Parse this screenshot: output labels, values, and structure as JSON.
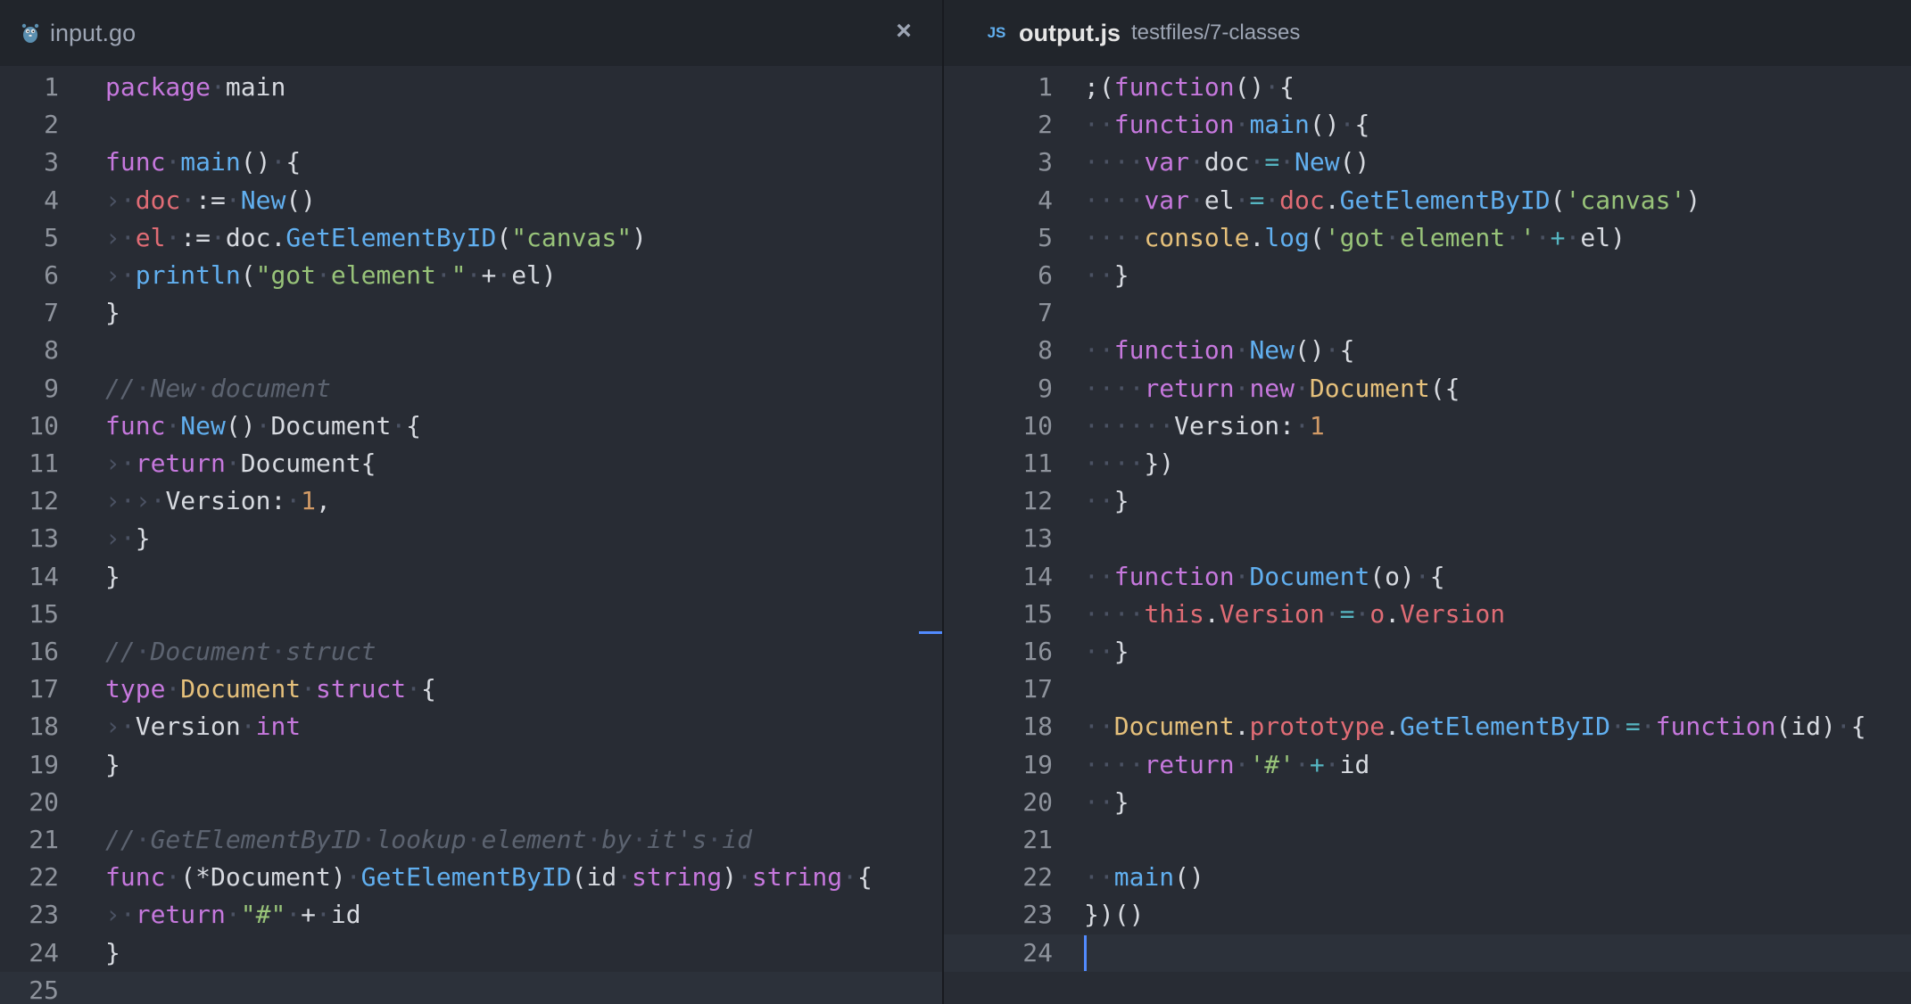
{
  "left_pane": {
    "tab": {
      "icon": "gopher-icon",
      "title": "input.go",
      "close": "×"
    },
    "lines": [
      [
        [
          "package",
          "kw"
        ],
        [
          "·",
          "ws"
        ],
        [
          "main",
          "plain"
        ]
      ],
      [],
      [
        [
          "func",
          "kw"
        ],
        [
          "·",
          "ws"
        ],
        [
          "main",
          "fn"
        ],
        [
          "()",
          "plain"
        ],
        [
          "·",
          "ws"
        ],
        [
          "{",
          "plain"
        ]
      ],
      [
        [
          "›",
          "ws"
        ],
        [
          "·",
          "ws"
        ],
        [
          "doc",
          "var"
        ],
        [
          "·",
          "ws"
        ],
        [
          ":=",
          "plain"
        ],
        [
          "·",
          "ws"
        ],
        [
          "New",
          "fn"
        ],
        [
          "()",
          "plain"
        ]
      ],
      [
        [
          "›",
          "ws"
        ],
        [
          "·",
          "ws"
        ],
        [
          "el",
          "var"
        ],
        [
          "·",
          "ws"
        ],
        [
          ":=",
          "plain"
        ],
        [
          "·",
          "ws"
        ],
        [
          "doc.",
          "plain"
        ],
        [
          "GetElementByID",
          "fn"
        ],
        [
          "(",
          "plain"
        ],
        [
          "\"canvas\"",
          "str"
        ],
        [
          ")",
          "plain"
        ]
      ],
      [
        [
          "›",
          "ws"
        ],
        [
          "·",
          "ws"
        ],
        [
          "println",
          "fn"
        ],
        [
          "(",
          "plain"
        ],
        [
          "\"got",
          "str"
        ],
        [
          "·",
          "ws"
        ],
        [
          "element",
          "str"
        ],
        [
          "·",
          "ws"
        ],
        [
          "\"",
          "str"
        ],
        [
          "·",
          "ws"
        ],
        [
          "+",
          "plain"
        ],
        [
          "·",
          "ws"
        ],
        [
          "el",
          "plain"
        ],
        [
          ")",
          "plain"
        ]
      ],
      [
        [
          "}",
          "plain"
        ]
      ],
      [],
      [
        [
          "//",
          "cm"
        ],
        [
          "·",
          "ws"
        ],
        [
          "New",
          "cm"
        ],
        [
          "·",
          "ws"
        ],
        [
          "document",
          "cm"
        ]
      ],
      [
        [
          "func",
          "kw"
        ],
        [
          "·",
          "ws"
        ],
        [
          "New",
          "fn"
        ],
        [
          "()",
          "plain"
        ],
        [
          "·",
          "ws"
        ],
        [
          "Document",
          "plain"
        ],
        [
          "·",
          "ws"
        ],
        [
          "{",
          "plain"
        ]
      ],
      [
        [
          "›",
          "ws"
        ],
        [
          "·",
          "ws"
        ],
        [
          "return",
          "kw"
        ],
        [
          "·",
          "ws"
        ],
        [
          "Document{",
          "plain"
        ]
      ],
      [
        [
          "›",
          "ws"
        ],
        [
          "·",
          "ws"
        ],
        [
          "›",
          "ws"
        ],
        [
          "·",
          "ws"
        ],
        [
          "Version:",
          "plain"
        ],
        [
          "·",
          "ws"
        ],
        [
          "1",
          "num"
        ],
        [
          ",",
          "plain"
        ]
      ],
      [
        [
          "›",
          "ws"
        ],
        [
          "·",
          "ws"
        ],
        [
          "}",
          "plain"
        ]
      ],
      [
        [
          "}",
          "plain"
        ]
      ],
      [],
      [
        [
          "//",
          "cm"
        ],
        [
          "·",
          "ws"
        ],
        [
          "Document",
          "cm"
        ],
        [
          "·",
          "ws"
        ],
        [
          "struct",
          "cm"
        ]
      ],
      [
        [
          "type",
          "kw"
        ],
        [
          "·",
          "ws"
        ],
        [
          "Document",
          "type"
        ],
        [
          "·",
          "ws"
        ],
        [
          "struct",
          "kw"
        ],
        [
          "·",
          "ws"
        ],
        [
          "{",
          "plain"
        ]
      ],
      [
        [
          "›",
          "ws"
        ],
        [
          "·",
          "ws"
        ],
        [
          "Version",
          "plain"
        ],
        [
          "·",
          "ws"
        ],
        [
          "int",
          "kw"
        ]
      ],
      [
        [
          "}",
          "plain"
        ]
      ],
      [],
      [
        [
          "//",
          "cm"
        ],
        [
          "·",
          "ws"
        ],
        [
          "GetElementByID",
          "cm"
        ],
        [
          "·",
          "ws"
        ],
        [
          "lookup",
          "cm"
        ],
        [
          "·",
          "ws"
        ],
        [
          "element",
          "cm"
        ],
        [
          "·",
          "ws"
        ],
        [
          "by",
          "cm"
        ],
        [
          "·",
          "ws"
        ],
        [
          "it's",
          "cm"
        ],
        [
          "·",
          "ws"
        ],
        [
          "id",
          "cm"
        ]
      ],
      [
        [
          "func",
          "kw"
        ],
        [
          "·",
          "ws"
        ],
        [
          "(*Document)",
          "plain"
        ],
        [
          "·",
          "ws"
        ],
        [
          "GetElementByID",
          "fn"
        ],
        [
          "(id",
          "plain"
        ],
        [
          "·",
          "ws"
        ],
        [
          "string",
          "kw"
        ],
        [
          ")",
          "plain"
        ],
        [
          "·",
          "ws"
        ],
        [
          "string",
          "kw"
        ],
        [
          "·",
          "ws"
        ],
        [
          "{",
          "plain"
        ]
      ],
      [
        [
          "›",
          "ws"
        ],
        [
          "·",
          "ws"
        ],
        [
          "return",
          "kw"
        ],
        [
          "·",
          "ws"
        ],
        [
          "\"#\"",
          "str"
        ],
        [
          "·",
          "ws"
        ],
        [
          "+",
          "plain"
        ],
        [
          "·",
          "ws"
        ],
        [
          "id",
          "plain"
        ]
      ],
      [
        [
          "}",
          "plain"
        ]
      ],
      []
    ]
  },
  "right_pane": {
    "tab": {
      "icon": "javascript-icon",
      "icon_text": "JS",
      "title": "output.js",
      "path": "testfiles/7-classes"
    },
    "lines": [
      [
        [
          ";(",
          "plain"
        ],
        [
          "function",
          "kw"
        ],
        [
          "()",
          "plain"
        ],
        [
          "·",
          "ws"
        ],
        [
          "{",
          "plain"
        ]
      ],
      [
        [
          "·",
          "ws"
        ],
        [
          "·",
          "ws"
        ],
        [
          "function",
          "kw"
        ],
        [
          "·",
          "ws"
        ],
        [
          "main",
          "fn"
        ],
        [
          "()",
          "plain"
        ],
        [
          "·",
          "ws"
        ],
        [
          "{",
          "plain"
        ]
      ],
      [
        [
          "·",
          "ws"
        ],
        [
          "·",
          "ws"
        ],
        [
          "·",
          "ws"
        ],
        [
          "·",
          "ws"
        ],
        [
          "var",
          "kw"
        ],
        [
          "·",
          "ws"
        ],
        [
          "doc",
          "plain"
        ],
        [
          "·",
          "ws"
        ],
        [
          "=",
          "op"
        ],
        [
          "·",
          "ws"
        ],
        [
          "New",
          "fn"
        ],
        [
          "()",
          "plain"
        ]
      ],
      [
        [
          "·",
          "ws"
        ],
        [
          "·",
          "ws"
        ],
        [
          "·",
          "ws"
        ],
        [
          "·",
          "ws"
        ],
        [
          "var",
          "kw"
        ],
        [
          "·",
          "ws"
        ],
        [
          "el",
          "plain"
        ],
        [
          "·",
          "ws"
        ],
        [
          "=",
          "op"
        ],
        [
          "·",
          "ws"
        ],
        [
          "doc",
          "var"
        ],
        [
          ".",
          "plain"
        ],
        [
          "GetElementByID",
          "fn"
        ],
        [
          "(",
          "plain"
        ],
        [
          "'canvas'",
          "str"
        ],
        [
          ")",
          "plain"
        ]
      ],
      [
        [
          "·",
          "ws"
        ],
        [
          "·",
          "ws"
        ],
        [
          "·",
          "ws"
        ],
        [
          "·",
          "ws"
        ],
        [
          "console",
          "type"
        ],
        [
          ".",
          "plain"
        ],
        [
          "log",
          "fn"
        ],
        [
          "(",
          "plain"
        ],
        [
          "'got",
          "str"
        ],
        [
          "·",
          "ws"
        ],
        [
          "element",
          "str"
        ],
        [
          "·",
          "ws"
        ],
        [
          "'",
          "str"
        ],
        [
          "·",
          "ws"
        ],
        [
          "+",
          "op"
        ],
        [
          "·",
          "ws"
        ],
        [
          "el",
          "plain"
        ],
        [
          ")",
          "plain"
        ]
      ],
      [
        [
          "·",
          "ws"
        ],
        [
          "·",
          "ws"
        ],
        [
          "}",
          "plain"
        ]
      ],
      [],
      [
        [
          "·",
          "ws"
        ],
        [
          "·",
          "ws"
        ],
        [
          "function",
          "kw"
        ],
        [
          "·",
          "ws"
        ],
        [
          "New",
          "fn"
        ],
        [
          "()",
          "plain"
        ],
        [
          "·",
          "ws"
        ],
        [
          "{",
          "plain"
        ]
      ],
      [
        [
          "·",
          "ws"
        ],
        [
          "·",
          "ws"
        ],
        [
          "·",
          "ws"
        ],
        [
          "·",
          "ws"
        ],
        [
          "return",
          "kw"
        ],
        [
          "·",
          "ws"
        ],
        [
          "new",
          "kw"
        ],
        [
          "·",
          "ws"
        ],
        [
          "Document",
          "type"
        ],
        [
          "({",
          "plain"
        ]
      ],
      [
        [
          "·",
          "ws"
        ],
        [
          "·",
          "ws"
        ],
        [
          "·",
          "ws"
        ],
        [
          "·",
          "ws"
        ],
        [
          "·",
          "ws"
        ],
        [
          "·",
          "ws"
        ],
        [
          "Version:",
          "plain"
        ],
        [
          "·",
          "ws"
        ],
        [
          "1",
          "num"
        ]
      ],
      [
        [
          "·",
          "ws"
        ],
        [
          "·",
          "ws"
        ],
        [
          "·",
          "ws"
        ],
        [
          "·",
          "ws"
        ],
        [
          "})",
          "plain"
        ]
      ],
      [
        [
          "·",
          "ws"
        ],
        [
          "·",
          "ws"
        ],
        [
          "}",
          "plain"
        ]
      ],
      [],
      [
        [
          "·",
          "ws"
        ],
        [
          "·",
          "ws"
        ],
        [
          "function",
          "kw"
        ],
        [
          "·",
          "ws"
        ],
        [
          "Document",
          "fn"
        ],
        [
          "(o)",
          "plain"
        ],
        [
          "·",
          "ws"
        ],
        [
          "{",
          "plain"
        ]
      ],
      [
        [
          "·",
          "ws"
        ],
        [
          "·",
          "ws"
        ],
        [
          "·",
          "ws"
        ],
        [
          "·",
          "ws"
        ],
        [
          "this",
          "var"
        ],
        [
          ".",
          "plain"
        ],
        [
          "Version",
          "var"
        ],
        [
          "·",
          "ws"
        ],
        [
          "=",
          "op"
        ],
        [
          "·",
          "ws"
        ],
        [
          "o",
          "var"
        ],
        [
          ".",
          "plain"
        ],
        [
          "Version",
          "var"
        ]
      ],
      [
        [
          "·",
          "ws"
        ],
        [
          "·",
          "ws"
        ],
        [
          "}",
          "plain"
        ]
      ],
      [],
      [
        [
          "·",
          "ws"
        ],
        [
          "·",
          "ws"
        ],
        [
          "Document",
          "type"
        ],
        [
          ".",
          "plain"
        ],
        [
          "prototype",
          "var"
        ],
        [
          ".",
          "plain"
        ],
        [
          "GetElementByID",
          "fn"
        ],
        [
          "·",
          "ws"
        ],
        [
          "=",
          "op"
        ],
        [
          "·",
          "ws"
        ],
        [
          "function",
          "kw"
        ],
        [
          "(id)",
          "plain"
        ],
        [
          "·",
          "ws"
        ],
        [
          "{",
          "plain"
        ]
      ],
      [
        [
          "·",
          "ws"
        ],
        [
          "·",
          "ws"
        ],
        [
          "·",
          "ws"
        ],
        [
          "·",
          "ws"
        ],
        [
          "return",
          "kw"
        ],
        [
          "·",
          "ws"
        ],
        [
          "'#'",
          "str"
        ],
        [
          "·",
          "ws"
        ],
        [
          "+",
          "op"
        ],
        [
          "·",
          "ws"
        ],
        [
          "id",
          "plain"
        ]
      ],
      [
        [
          "·",
          "ws"
        ],
        [
          "·",
          "ws"
        ],
        [
          "}",
          "plain"
        ]
      ],
      [],
      [
        [
          "·",
          "ws"
        ],
        [
          "·",
          "ws"
        ],
        [
          "main",
          "fn"
        ],
        [
          "()",
          "plain"
        ]
      ],
      [
        [
          "})()",
          "plain"
        ]
      ],
      []
    ]
  }
}
